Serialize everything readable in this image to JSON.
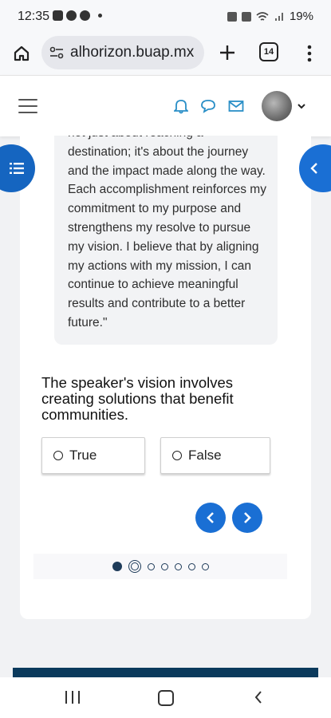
{
  "status_bar": {
    "time": "12:35",
    "battery": "19%"
  },
  "browser": {
    "url": "alhorizon.buap.mx",
    "tab_count": "14"
  },
  "colors": {
    "accent": "#1a6fd4",
    "dark_navy": "#0b3a5c",
    "icon_blue": "#2a8fc7"
  },
  "header": {
    "icons": [
      "bell-icon",
      "chat-bubble-icon",
      "mail-icon"
    ],
    "menu_icon": "hamburger-icon"
  },
  "quote": {
    "text": "not just about reaching a destination; it's about the journey and the impact made along the way. Each accomplishment reinforces my commitment to my purpose and strengthens my resolve to pursue my vision. I believe that by aligning my actions with my mission, I can continue to achieve meaningful results and contribute to a better future.\""
  },
  "question": {
    "text": "The speaker's vision involves creating solutions that benefit communities.",
    "options": [
      {
        "label": "True"
      },
      {
        "label": "False"
      }
    ]
  },
  "navigation": {
    "prev_icon": "chevron-left-icon",
    "next_icon": "chevron-right-icon"
  },
  "pagination": {
    "total": 7,
    "current": 2
  }
}
